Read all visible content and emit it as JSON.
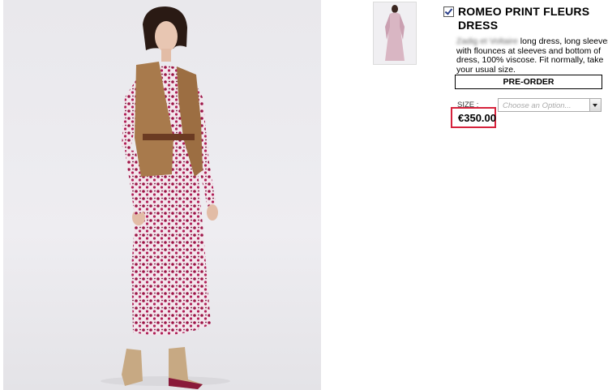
{
  "product": {
    "title": "ROMEO PRINT FLEURS DRESS",
    "description_blurred": "Zadig et Voltaire",
    "description_rest": " long dress, long sleeves, with flounces at sleeves and bottom of dress, 100% viscose. Fit normally, take your usual size.",
    "preorder_label": "PRE-ORDER",
    "size_label": "SIZE :",
    "size_placeholder": "Choose an Option...",
    "price": "€350.00",
    "selected": true
  },
  "colors": {
    "price_highlight": "#d6223c",
    "dress_base": "#f2e4ea",
    "dress_print": "#a0154a",
    "vest": "#a87a4c"
  },
  "icons": {
    "checkbox": "checkbox-checked-icon",
    "select_arrow": "chevron-down-icon"
  }
}
